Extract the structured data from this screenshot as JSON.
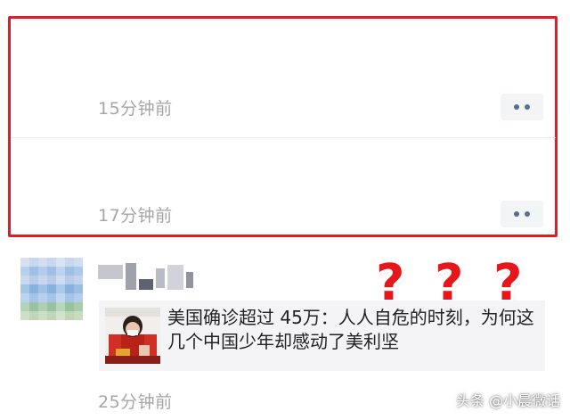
{
  "moments": [
    {
      "timestamp": "15分钟前"
    },
    {
      "timestamp": "17分钟前"
    },
    {
      "timestamp": "25分钟前"
    }
  ],
  "shared_article": {
    "title": "美国确诊超过 45万：人人自危的时刻，为何这几个中国少年却感动了美利坚"
  },
  "question_marks": [
    "?",
    "?",
    "?"
  ],
  "watermark": "头条 @小晨微话",
  "colors": {
    "highlight_border": "#e01d25",
    "timestamp_text": "#a6a6a6",
    "more_button_dots": "#5a6d93",
    "question_mark": "#e5161c",
    "article_card_bg": "#f4f4f6"
  },
  "icons": {
    "more_button": "two-dot-more-icon",
    "question_mark": "question-mark-icon"
  }
}
